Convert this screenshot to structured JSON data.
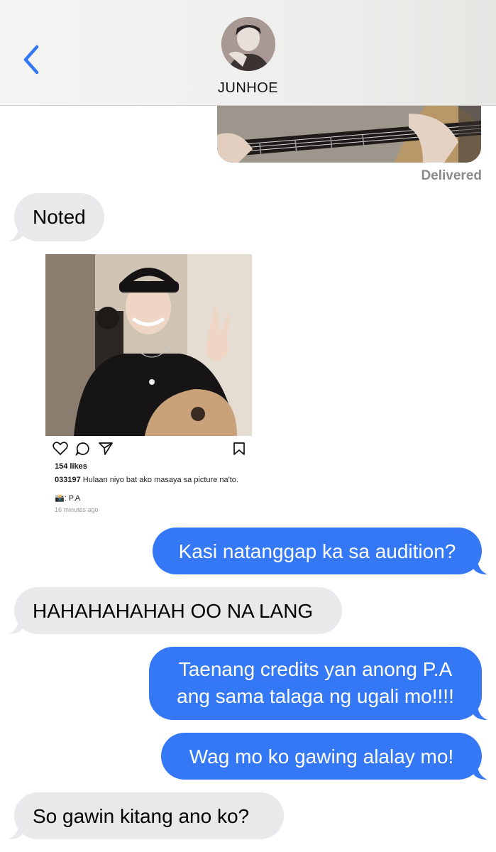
{
  "header": {
    "contact_name": "JUNHOE"
  },
  "status": {
    "delivered": "Delivered"
  },
  "messages": [
    {
      "side": "in",
      "text": "Noted"
    },
    {
      "side": "out",
      "text": "Kasi natanggap ka sa audition?"
    },
    {
      "side": "in",
      "text": "HAHAHAHAHAH OO NA LANG"
    },
    {
      "side": "out",
      "lines": [
        "Taenang credits yan anong P.A",
        "ang sama talaga ng ugali mo!!!!"
      ]
    },
    {
      "side": "out",
      "text": "Wag mo ko gawing alalay mo!"
    },
    {
      "side": "in",
      "text": "So gawin kitang ano ko?"
    }
  ],
  "post": {
    "likes": "154 likes",
    "username": "033197",
    "caption": "Hulaan niyo bat ako masaya sa picture na'to.",
    "credit": "📸: P.A",
    "time": "16 minutes ago"
  },
  "colors": {
    "sent_bubble": "#3478f6",
    "received_bubble": "#e9e9eb",
    "accent": "#3478f6"
  },
  "icons": [
    "chevron-left-icon",
    "heart-icon",
    "comment-icon",
    "send-icon",
    "bookmark-icon"
  ]
}
